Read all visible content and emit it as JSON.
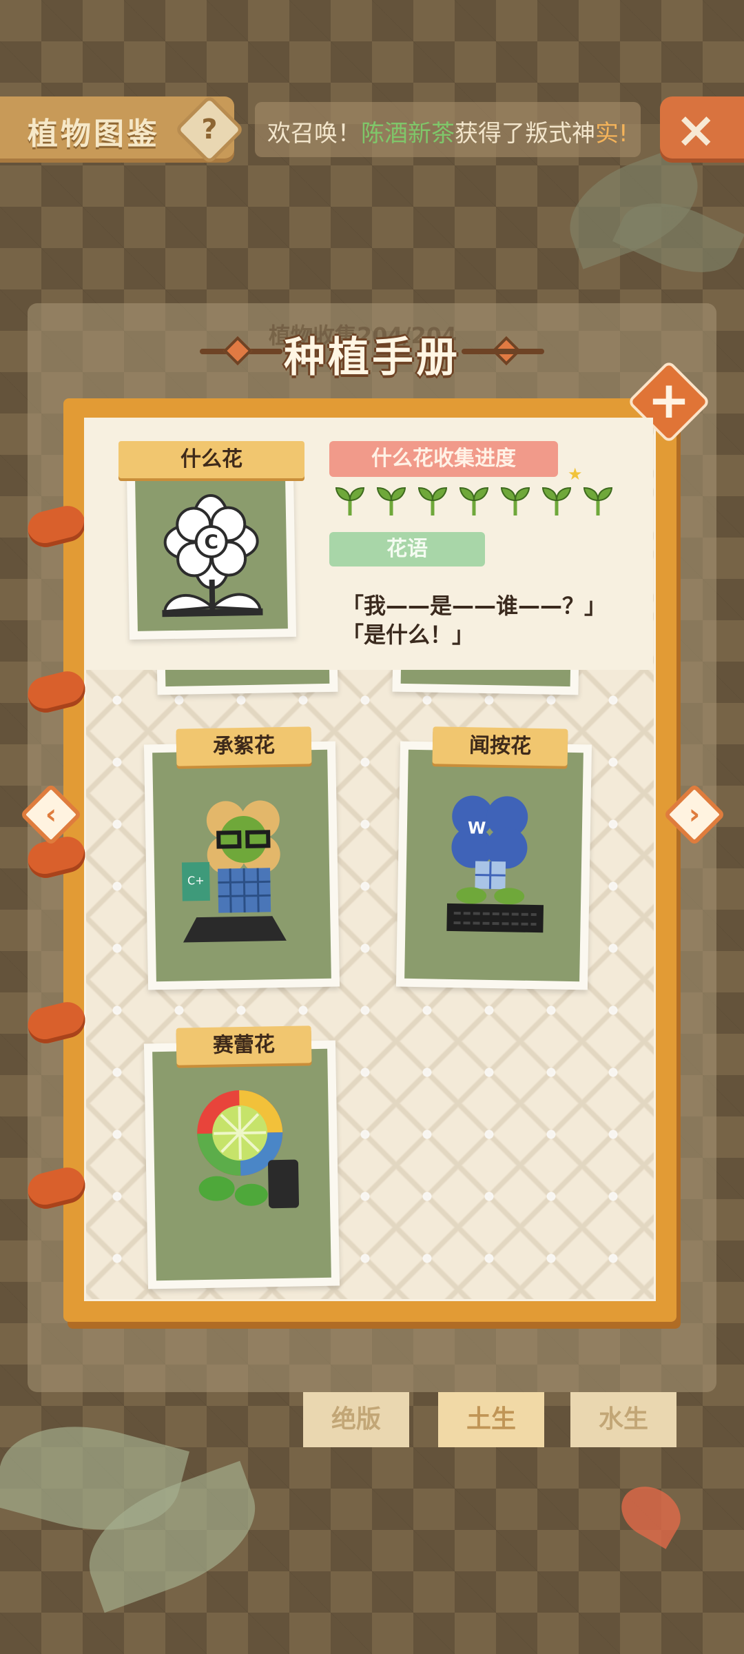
{
  "header": {
    "title": "植物图鉴",
    "help_label": "?",
    "marquee_prefix": "欢召唤！",
    "marquee_name": "陈酒新茶",
    "marquee_mid": "获得了叛式神",
    "marquee_suffix": "实!",
    "close_label": "×"
  },
  "background": {
    "collection_text": "植物收集204/204"
  },
  "book": {
    "title": "种植手册",
    "add_label": "+"
  },
  "detail": {
    "name": "什么花",
    "progress_label": "什么花收集进度",
    "progress_count": 7,
    "flower_language_label": "花语",
    "quote_line1": "「我——是——谁——？」",
    "quote_line2": "「是什么！」"
  },
  "cards": [
    {
      "name": "承絮花"
    },
    {
      "name": "闻按花"
    },
    {
      "name": "赛蕾花"
    }
  ],
  "tabs": [
    {
      "label": "绝版"
    },
    {
      "label": "土生"
    },
    {
      "label": "水生"
    }
  ],
  "nav": {
    "prev_label": "‹",
    "next_label": "›"
  },
  "colors": {
    "book_orange": "#e29b35",
    "page_cream": "#f3ead8",
    "tag_yellow": "#f1c66f",
    "progress_pink": "#f19a8a",
    "language_green": "#a8d6a8",
    "sprout_green": "#6fa83a"
  }
}
